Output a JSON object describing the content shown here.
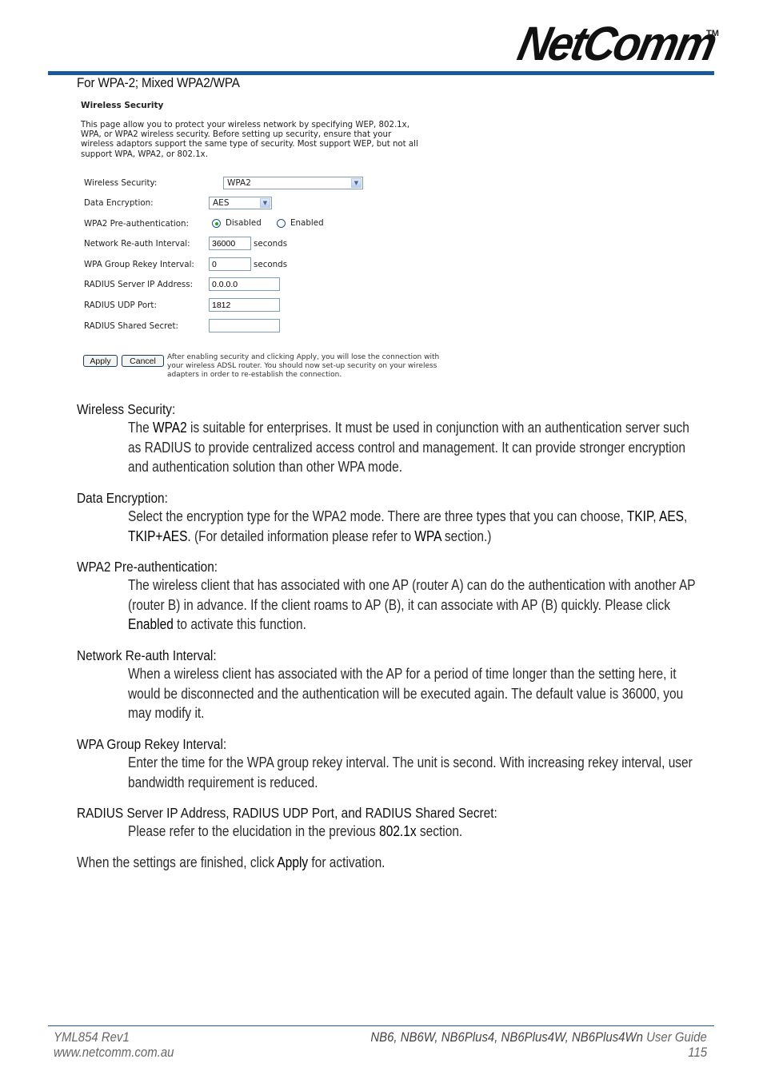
{
  "header": {
    "logo_text": "NetComm",
    "logo_tm": "TM",
    "brand_color": "#1b5a9a"
  },
  "section_title": "For WPA-2; Mixed WPA2/WPA",
  "router_ui": {
    "title": "Wireless Security",
    "description": "This page allow you to protect your wireless network by specifying WEP, 802.1x, WPA, or WPA2 wireless security. Before setting up security, ensure that your wireless adaptors support the same type of security. Most support WEP, but not all support WPA, WPA2, or 802.1x.",
    "fields": {
      "wireless_security": {
        "label": "Wireless Security:",
        "value": "WPA2"
      },
      "data_encryption": {
        "label": "Data Encryption:",
        "value": "AES"
      },
      "preauth": {
        "label": "WPA2 Pre-authentication:",
        "options": [
          "Disabled",
          "Enabled"
        ],
        "selected": "Disabled"
      },
      "reauth_interval": {
        "label": "Network Re-auth Interval:",
        "value": "36000",
        "unit": "seconds"
      },
      "rekey_interval": {
        "label": "WPA Group Rekey Interval:",
        "value": "0",
        "unit": "seconds"
      },
      "radius_ip": {
        "label": "RADIUS Server IP Address:",
        "value": "0.0.0.0"
      },
      "radius_port": {
        "label": "RADIUS UDP Port:",
        "value": "1812"
      },
      "radius_secret": {
        "label": "RADIUS Shared Secret:",
        "value": ""
      }
    },
    "buttons": {
      "apply": "Apply",
      "cancel": "Cancel"
    },
    "note": "After enabling security and clicking Apply, you will lose the connection with your wireless ADSL router. You should now set-up security on your wireless adapters in order to re-establish the connection."
  },
  "descriptions": [
    {
      "term": "Wireless Security:",
      "parts": [
        "The ",
        "WPA2",
        " is suitable for enterprises. It must be used in conjunction with an authentication server such as RADIUS to provide centralized access control and management. It can provide stronger encryption and authentication solution than other WPA mode."
      ]
    },
    {
      "term": "Data Encryption:",
      "parts": [
        "Select the encryption type for the WPA2 mode. There are three types that you can choose, ",
        "TKIP",
        ", ",
        "AES",
        ", ",
        "TKIP+AES",
        ". (For detailed information please refer to ",
        "WPA",
        " section.)"
      ]
    },
    {
      "term": "WPA2 Pre-authentication:",
      "parts": [
        "The wireless client that has associated with one AP (router A) can do the authentication with another AP (router B) in advance. If the client roams to AP (B), it can associate with AP (B) quickly. Please click ",
        "Enabled",
        " to activate this function."
      ]
    },
    {
      "term": "Network Re-auth Interval:",
      "parts": [
        "When a wireless client has associated with the AP for a period of time longer than the setting here, it would be disconnected and the authentication will be executed again. The default value is 36000, you may modify it."
      ]
    },
    {
      "term": "WPA Group Rekey Interval:",
      "parts": [
        "Enter the time for the WPA group rekey interval. The unit is second. With increasing rekey interval, user bandwidth requirement is reduced."
      ]
    },
    {
      "term": "RADIUS Server IP Address, RADIUS UDP Port, and RADIUS Shared Secret:",
      "parts": [
        "Please refer to the elucidation in the previous ",
        "802.1x",
        " section."
      ]
    }
  ],
  "closing": {
    "before": "When the settings are finished, click ",
    "emphasis": "Apply",
    "after": " for activation."
  },
  "footer": {
    "doc_id": "YML854 Rev1",
    "website": "www.netcomm.com.au",
    "models": "NB6, NB6W, NB6Plus4, NB6Plus4W, NB6Plus4Wn",
    "guide_label": "User Guide",
    "page_number": "115"
  }
}
